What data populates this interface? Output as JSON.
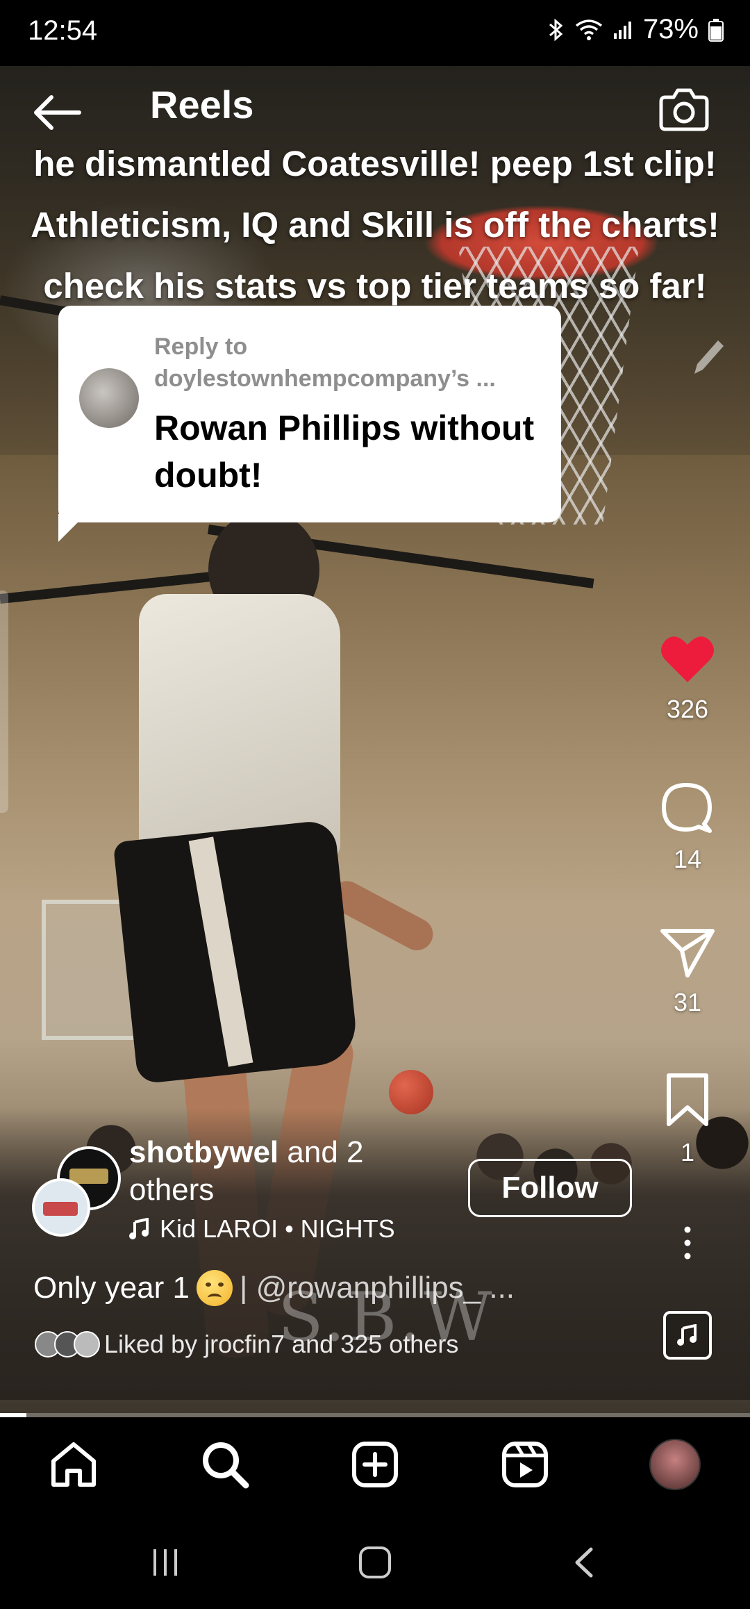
{
  "status_bar": {
    "time": "12:54",
    "battery": "73%",
    "icons": [
      "bluetooth-icon",
      "wifi-icon",
      "signal-icon",
      "battery-icon"
    ]
  },
  "header": {
    "title": "Reels",
    "back_icon": "arrow-left-icon",
    "camera_icon": "camera-icon"
  },
  "video": {
    "caption_lines": [
      "he dismantled Coatesville! peep 1st clip!",
      "Athleticism, IQ and Skill is off the charts!",
      "check his stats vs top tier teams so far!"
    ],
    "watermark": "S.B.W"
  },
  "reply_sticker": {
    "label": "Reply to",
    "username": "doylestownhempcompany’s ...",
    "comment": "Rowan Phillips without doubt!"
  },
  "actions": {
    "like": {
      "icon": "heart-icon",
      "count": "326",
      "color": "#ed1c3c"
    },
    "comment": {
      "icon": "comment-icon",
      "count": "14"
    },
    "share": {
      "icon": "send-icon",
      "count": "31"
    },
    "save": {
      "icon": "bookmark-icon",
      "count": "1"
    },
    "more": {
      "icon": "more-vertical-icon"
    }
  },
  "post": {
    "author": "shotbywel",
    "coauthors": "and 2 others",
    "follow_label": "Follow",
    "music": "Kid LAROI • NIGHTS",
    "caption_prefix": "Only year 1",
    "caption_mention": "| @rowanphillips_ ...",
    "liked_by": "Liked by jrocfin7 and 325 others"
  },
  "progress": {
    "fraction": 0.035
  },
  "bottom_nav": {
    "items": [
      "home-icon",
      "search-icon",
      "create-icon",
      "reels-icon",
      "profile-avatar"
    ]
  },
  "system_nav": {
    "items": [
      "recent-apps-icon",
      "home-button-icon",
      "back-button-icon"
    ]
  }
}
